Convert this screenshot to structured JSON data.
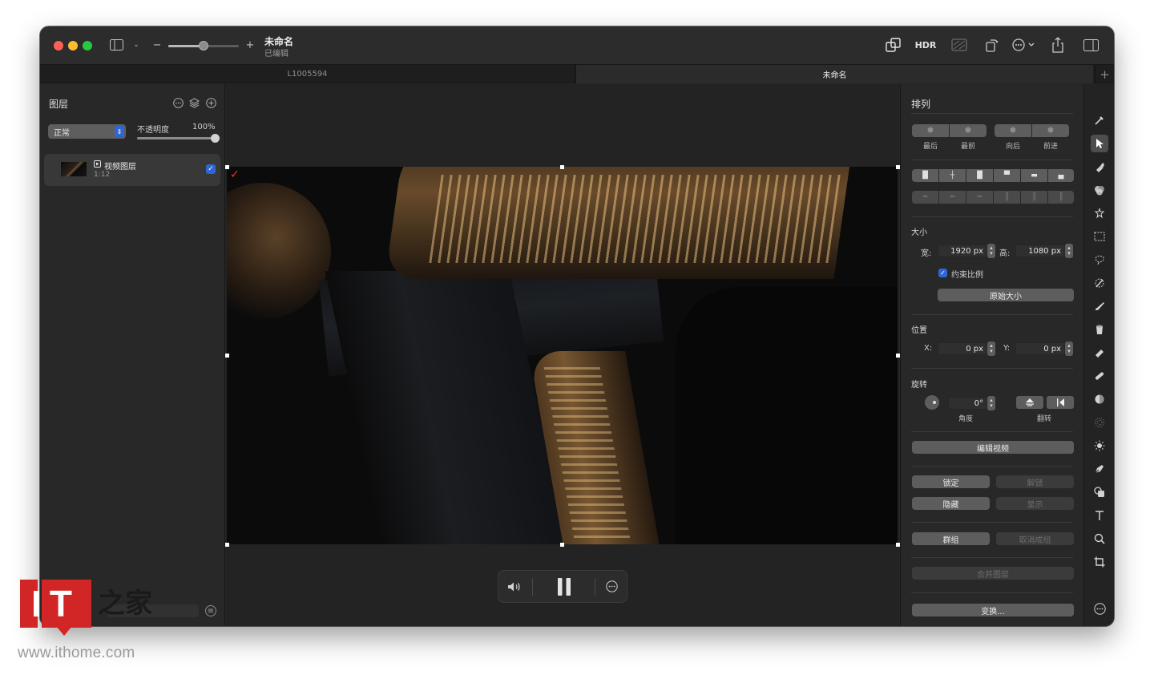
{
  "titlebar": {
    "doc_title": "未命名",
    "doc_subtitle": "已编辑",
    "zoom_minus": "−",
    "zoom_plus": "+",
    "hdr": "HDR"
  },
  "tabs": [
    {
      "label": "L1005594",
      "active": false
    },
    {
      "label": "未命名",
      "active": true
    }
  ],
  "tab_add": "+",
  "layers_panel": {
    "title": "图层",
    "blend_mode": "正常",
    "opacity_label": "不透明度",
    "opacity_value": "100%",
    "opacity": 1.0,
    "layer": {
      "name": "视频图层",
      "duration": "1:12",
      "visible": true
    }
  },
  "playback": {
    "state": "playing"
  },
  "arrange_panel": {
    "title": "排列",
    "order_buttons": [
      "最后",
      "最前",
      "向后",
      "前进"
    ],
    "size": {
      "label": "大小",
      "width_label": "宽:",
      "width_value": "1920 px",
      "height_label": "高:",
      "height_value": "1080 px",
      "constrain_label": "约束比例",
      "constrain_checked": true,
      "original_size_button": "原始大小"
    },
    "position": {
      "label": "位置",
      "x_label": "X:",
      "x_value": "0 px",
      "y_label": "Y:",
      "y_value": "0 px"
    },
    "rotation": {
      "label": "旋转",
      "angle_value": "0°",
      "angle_label": "角度",
      "flip_label": "翻转"
    },
    "edit_video_button": "编辑视频",
    "lock_button": "锁定",
    "unlock_button": "解锁",
    "hide_button": "隐藏",
    "show_button": "显示",
    "group_button": "群组",
    "ungroup_button": "取消成组",
    "merge_button": "合并图层",
    "transform_button": "变换..."
  },
  "watermark": {
    "logo_letters": "IT",
    "logo_chars": "之家",
    "url": "www.ithome.com"
  },
  "colors": {
    "accent": "#2f66d6",
    "window_bg": "#262626",
    "close": "#fe5f57",
    "minimize": "#febc2e",
    "maximize": "#28c840",
    "watermark_red": "#d22626"
  }
}
